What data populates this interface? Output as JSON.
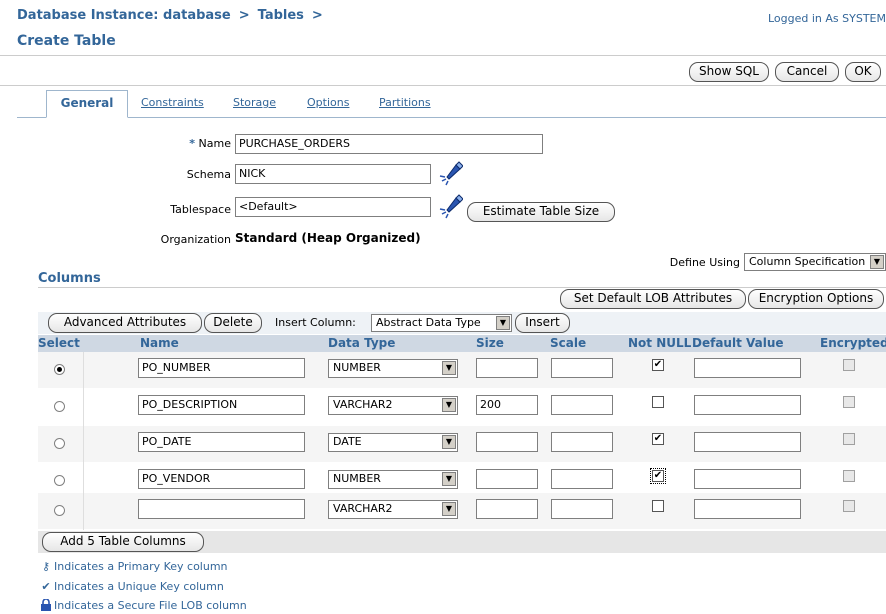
{
  "header": {
    "breadcrumb": [
      "Database Instance: database",
      "Tables"
    ],
    "breadcrumb_sep": ">",
    "title": "Create Table",
    "login": "Logged in As SYSTEM"
  },
  "actions": {
    "show_sql": "Show SQL",
    "cancel": "Cancel",
    "ok": "OK"
  },
  "tabs": {
    "general": "General",
    "constraints": "Constraints",
    "storage": "Storage",
    "options": "Options",
    "partitions": "Partitions"
  },
  "form": {
    "name_required": "*",
    "name_label": "Name",
    "name_value": "PURCHASE_ORDERS",
    "schema_label": "Schema",
    "schema_value": "NICK",
    "tablespace_label": "Tablespace",
    "tablespace_value": "<Default>",
    "estimate_button": "Estimate Table Size",
    "organization_label": "Organization",
    "organization_value": "Standard (Heap Organized)"
  },
  "columns_section": {
    "title": "Columns",
    "define_using_label": "Define Using",
    "define_using_value": "Column Specification",
    "set_default_lob": "Set Default LOB Attributes",
    "encryption_options": "Encryption Options",
    "advanced_attributes": "Advanced Attributes",
    "delete": "Delete",
    "insert_column_label": "Insert Column:",
    "insert_type": "Abstract Data Type",
    "insert": "Insert",
    "headers": {
      "select": "Select",
      "name": "Name",
      "data_type": "Data Type",
      "size": "Size",
      "scale": "Scale",
      "not_null": "Not NULL",
      "default_value": "Default Value",
      "encrypted": "Encrypted"
    },
    "rows": [
      {
        "selected": true,
        "name": "PO_NUMBER",
        "type": "NUMBER",
        "size": "",
        "scale": "",
        "not_null": true,
        "default": "",
        "encrypted": false
      },
      {
        "selected": false,
        "name": "PO_DESCRIPTION",
        "type": "VARCHAR2",
        "size": "200",
        "scale": "",
        "not_null": false,
        "default": "",
        "encrypted": false
      },
      {
        "selected": false,
        "name": "PO_DATE",
        "type": "DATE",
        "size": "",
        "scale": "",
        "not_null": true,
        "default": "",
        "encrypted": false
      },
      {
        "selected": false,
        "name": "PO_VENDOR",
        "type": "NUMBER",
        "size": "",
        "scale": "",
        "not_null": true,
        "default": "",
        "encrypted": false
      },
      {
        "selected": false,
        "name": "",
        "type": "VARCHAR2",
        "size": "",
        "scale": "",
        "not_null": false,
        "default": "",
        "encrypted": false
      }
    ],
    "add_columns": "Add 5 Table Columns"
  },
  "legend": {
    "primary_key": "Indicates a Primary Key column",
    "unique_key": "Indicates a Unique Key column",
    "secure_lob": "Indicates a Secure File LOB column"
  },
  "icons": {
    "torch": "flashlight-search-icon",
    "primary_key": "key-icon",
    "unique_key": "checkmark-icon",
    "secure_lob": "lock-icon",
    "dropdown": "chevron-down-icon"
  },
  "colors": {
    "link": "#336699",
    "table_header": "#cfd8e3",
    "row_alt": "#f5f5f5"
  }
}
